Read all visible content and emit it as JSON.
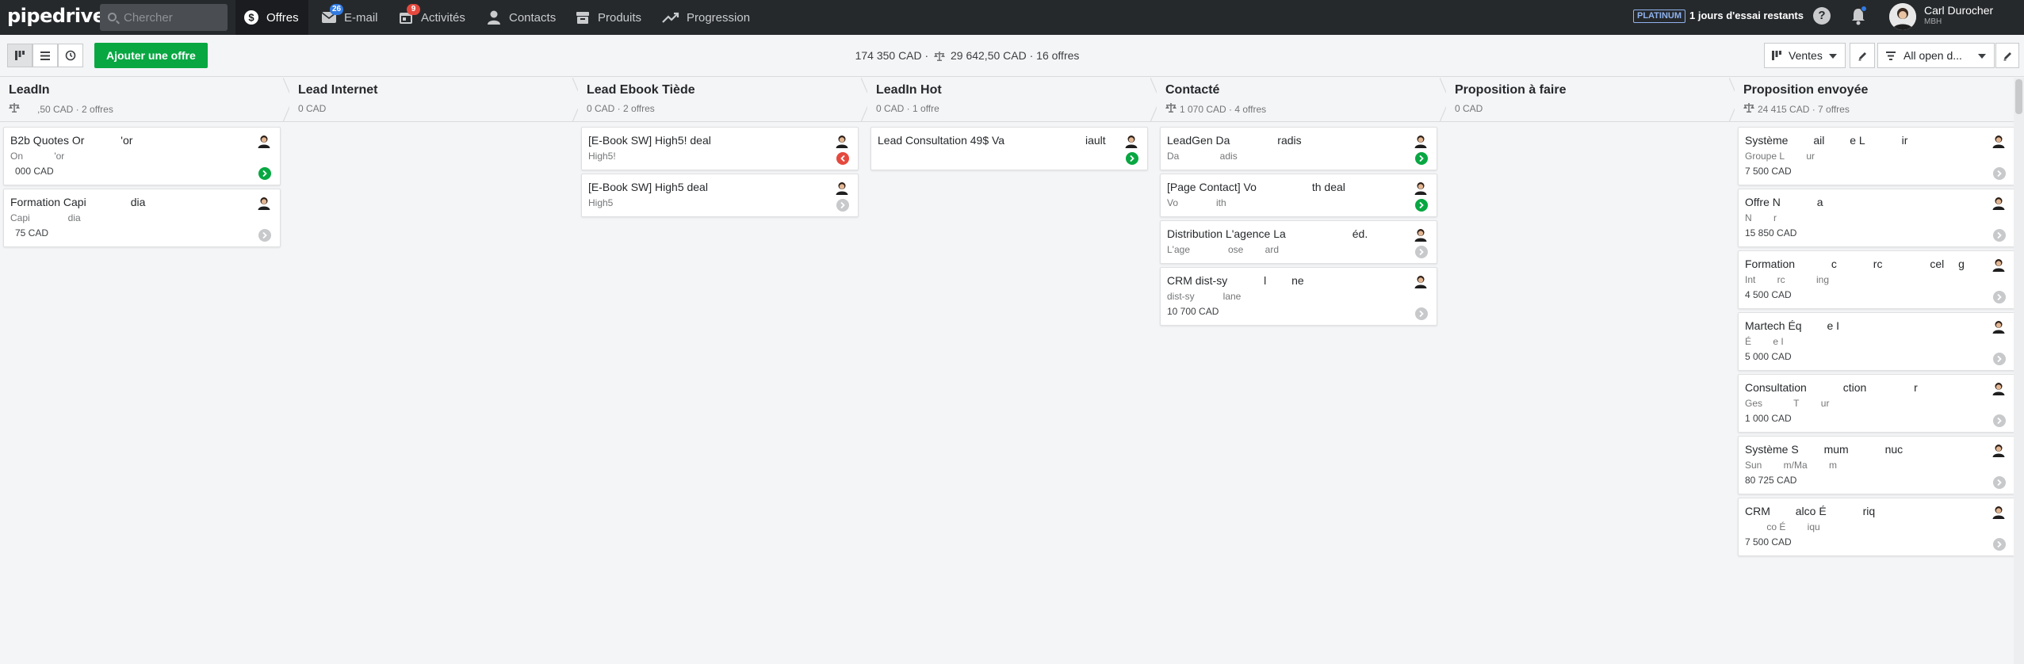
{
  "nav": {
    "logo": "pipedrive",
    "search_placeholder": "Chercher",
    "items": [
      {
        "label": "Offres",
        "icon": "dollar-icon",
        "active": true
      },
      {
        "label": "E-mail",
        "icon": "envelope-icon",
        "badge": "26"
      },
      {
        "label": "Activités",
        "icon": "calendar-icon",
        "badge": "9"
      },
      {
        "label": "Contacts",
        "icon": "person-icon"
      },
      {
        "label": "Produits",
        "icon": "box-icon"
      },
      {
        "label": "Progression",
        "icon": "trend-icon"
      }
    ],
    "plan_badge": "PLATINUM",
    "trial_text": "1 jours d'essai restants",
    "help_symbol": "?",
    "user_name": "Carl Durocher",
    "user_company": "MBH"
  },
  "toolbar": {
    "add_button": "Ajouter une offre",
    "total_value": "174 350 CAD",
    "weighted_value": "29 642,50 CAD",
    "deal_count": "16 offres",
    "pipeline_label": "Ventes",
    "filter_label": "All open d..."
  },
  "columns": [
    {
      "title": "LeadIn",
      "summary": "   ,50 CAD · 2 offres",
      "weighted": true,
      "cards": [
        {
          "title": "B2b Quotes Or    'or",
          "org": "On    'or",
          "value": " 000 CAD",
          "status": "green"
        },
        {
          "title": "Formation Capi    dia",
          "org": "Capi    dia",
          "value": " 75 CAD",
          "status": "grey"
        }
      ]
    },
    {
      "title": "Lead Internet",
      "summary": "0 CAD",
      "weighted": false,
      "cards": []
    },
    {
      "title": "Lead Ebook Tiède",
      "summary": "0 CAD · 2 offres",
      "weighted": false,
      "cards": [
        {
          "title": "[E-Book SW] High5! deal",
          "org": "High5!",
          "value": "",
          "status": "red"
        },
        {
          "title": "[E-Book SW] High5 deal",
          "org": "High5",
          "value": "",
          "status": "grey"
        }
      ]
    },
    {
      "title": "LeadIn Hot",
      "summary": "0 CAD · 1 offre",
      "weighted": false,
      "cards": [
        {
          "title": "Lead Consultation 49$ Va        iault",
          "org": "",
          "value": "",
          "status": "green"
        }
      ]
    },
    {
      "title": "Contacté",
      "summary": "1 070 CAD · 4 offres",
      "weighted": true,
      "cards": [
        {
          "title": "LeadGen Da     radis",
          "org": "Da     adis",
          "value": "",
          "status": "green"
        },
        {
          "title": "[Page Contact] Vo     th deal",
          "org": "Vo    ith",
          "value": "",
          "status": "green"
        },
        {
          "title": "Distribution L'agence La      éd.",
          "org": "L'age    ose   ard",
          "value": "",
          "status": "grey"
        },
        {
          "title": "CRM dist-sy    l   ne",
          "org": "dist-sy   lane",
          "value": "10 700 CAD",
          "status": "grey"
        }
      ]
    },
    {
      "title": "Proposition à faire",
      "summary": "0 CAD",
      "weighted": false,
      "cards": []
    },
    {
      "title": "Proposition envoyée",
      "summary": "24 415 CAD · 7 offres",
      "weighted": true,
      "cards": [
        {
          "title": "Système   ail   e L    ir",
          "org": "Groupe L   ur",
          "value": "7 500 CAD",
          "status": "grey"
        },
        {
          "title": "Offre N    a",
          "org": "N   r",
          "value": "15 850 CAD",
          "status": "grey"
        },
        {
          "title": "Formation    c    rc     cel  g",
          "org": "Int   rc    ing",
          "value": "4 500 CAD",
          "status": "grey"
        },
        {
          "title": "Martech Éq   e I",
          "org": "É   e I",
          "value": "5 000 CAD",
          "status": "grey"
        },
        {
          "title": "Consultation    ction     r",
          "org": "Ges    T   ur",
          "value": "1 000 CAD",
          "status": "grey"
        },
        {
          "title": "Système S   mum    nuc",
          "org": "Sun   m/Ma   m",
          "value": "80 725 CAD",
          "status": "grey"
        },
        {
          "title": "CRM   alco É    riq",
          "org": "   co É   iqu",
          "value": "7 500 CAD",
          "status": "grey"
        }
      ]
    }
  ]
}
